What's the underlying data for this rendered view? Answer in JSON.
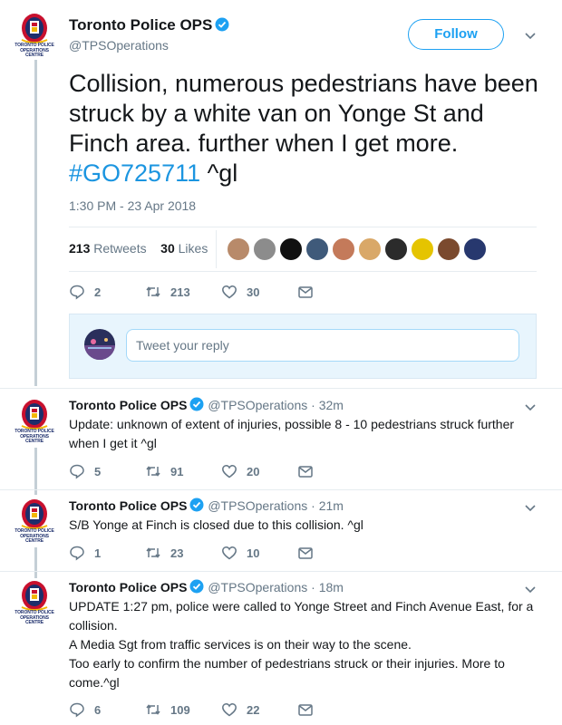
{
  "account": {
    "name": "Toronto Police OPS",
    "handle": "@TPSOperations",
    "avatar_caption": [
      "TORONTO POLICE",
      "OPERATIONS",
      "CENTRE"
    ]
  },
  "main_tweet": {
    "follow_label": "Follow",
    "text": "Collision, numerous pedestrians have been struck by a white van on Yonge St and Finch area. further when I get more.",
    "hashtag": "#GO725711",
    "suffix": " ^gl",
    "timestamp": "1:30 PM - 23 Apr 2018",
    "retweets_count": "213",
    "retweets_label": "Retweets",
    "likes_count": "30",
    "likes_label": "Likes",
    "actions": {
      "replies": "2",
      "retweets": "213",
      "likes": "30"
    }
  },
  "reply_box": {
    "placeholder": "Tweet your reply"
  },
  "replies": [
    {
      "time": "32m",
      "text": "Update: unknown of extent of injuries, possible 8 - 10 pedestrians struck further when I get it ^gl",
      "actions": {
        "replies": "5",
        "retweets": "91",
        "likes": "20"
      }
    },
    {
      "time": "21m",
      "text": "S/B Yonge at Finch is closed due to this collision. ^gl",
      "actions": {
        "replies": "1",
        "retweets": "23",
        "likes": "10"
      }
    },
    {
      "time": "18m",
      "text_lines": [
        "UPDATE 1:27 pm, police were called to Yonge Street and Finch Avenue East, for a collision.",
        "A Media Sgt from traffic services is on their way to the scene.",
        "Too early to confirm the number of pedestrians struck or their injuries. More to come.^gl"
      ],
      "actions": {
        "replies": "6",
        "retweets": "109",
        "likes": "22"
      }
    }
  ],
  "colors": {
    "accent": "#1da1f2",
    "muted": "#657786",
    "text": "#14171a",
    "verified": "#1da1f2"
  },
  "icons": [
    "police-crest-icon",
    "verified-badge-icon",
    "chevron-down-icon",
    "reply-icon",
    "retweet-icon",
    "heart-icon",
    "message-icon"
  ]
}
